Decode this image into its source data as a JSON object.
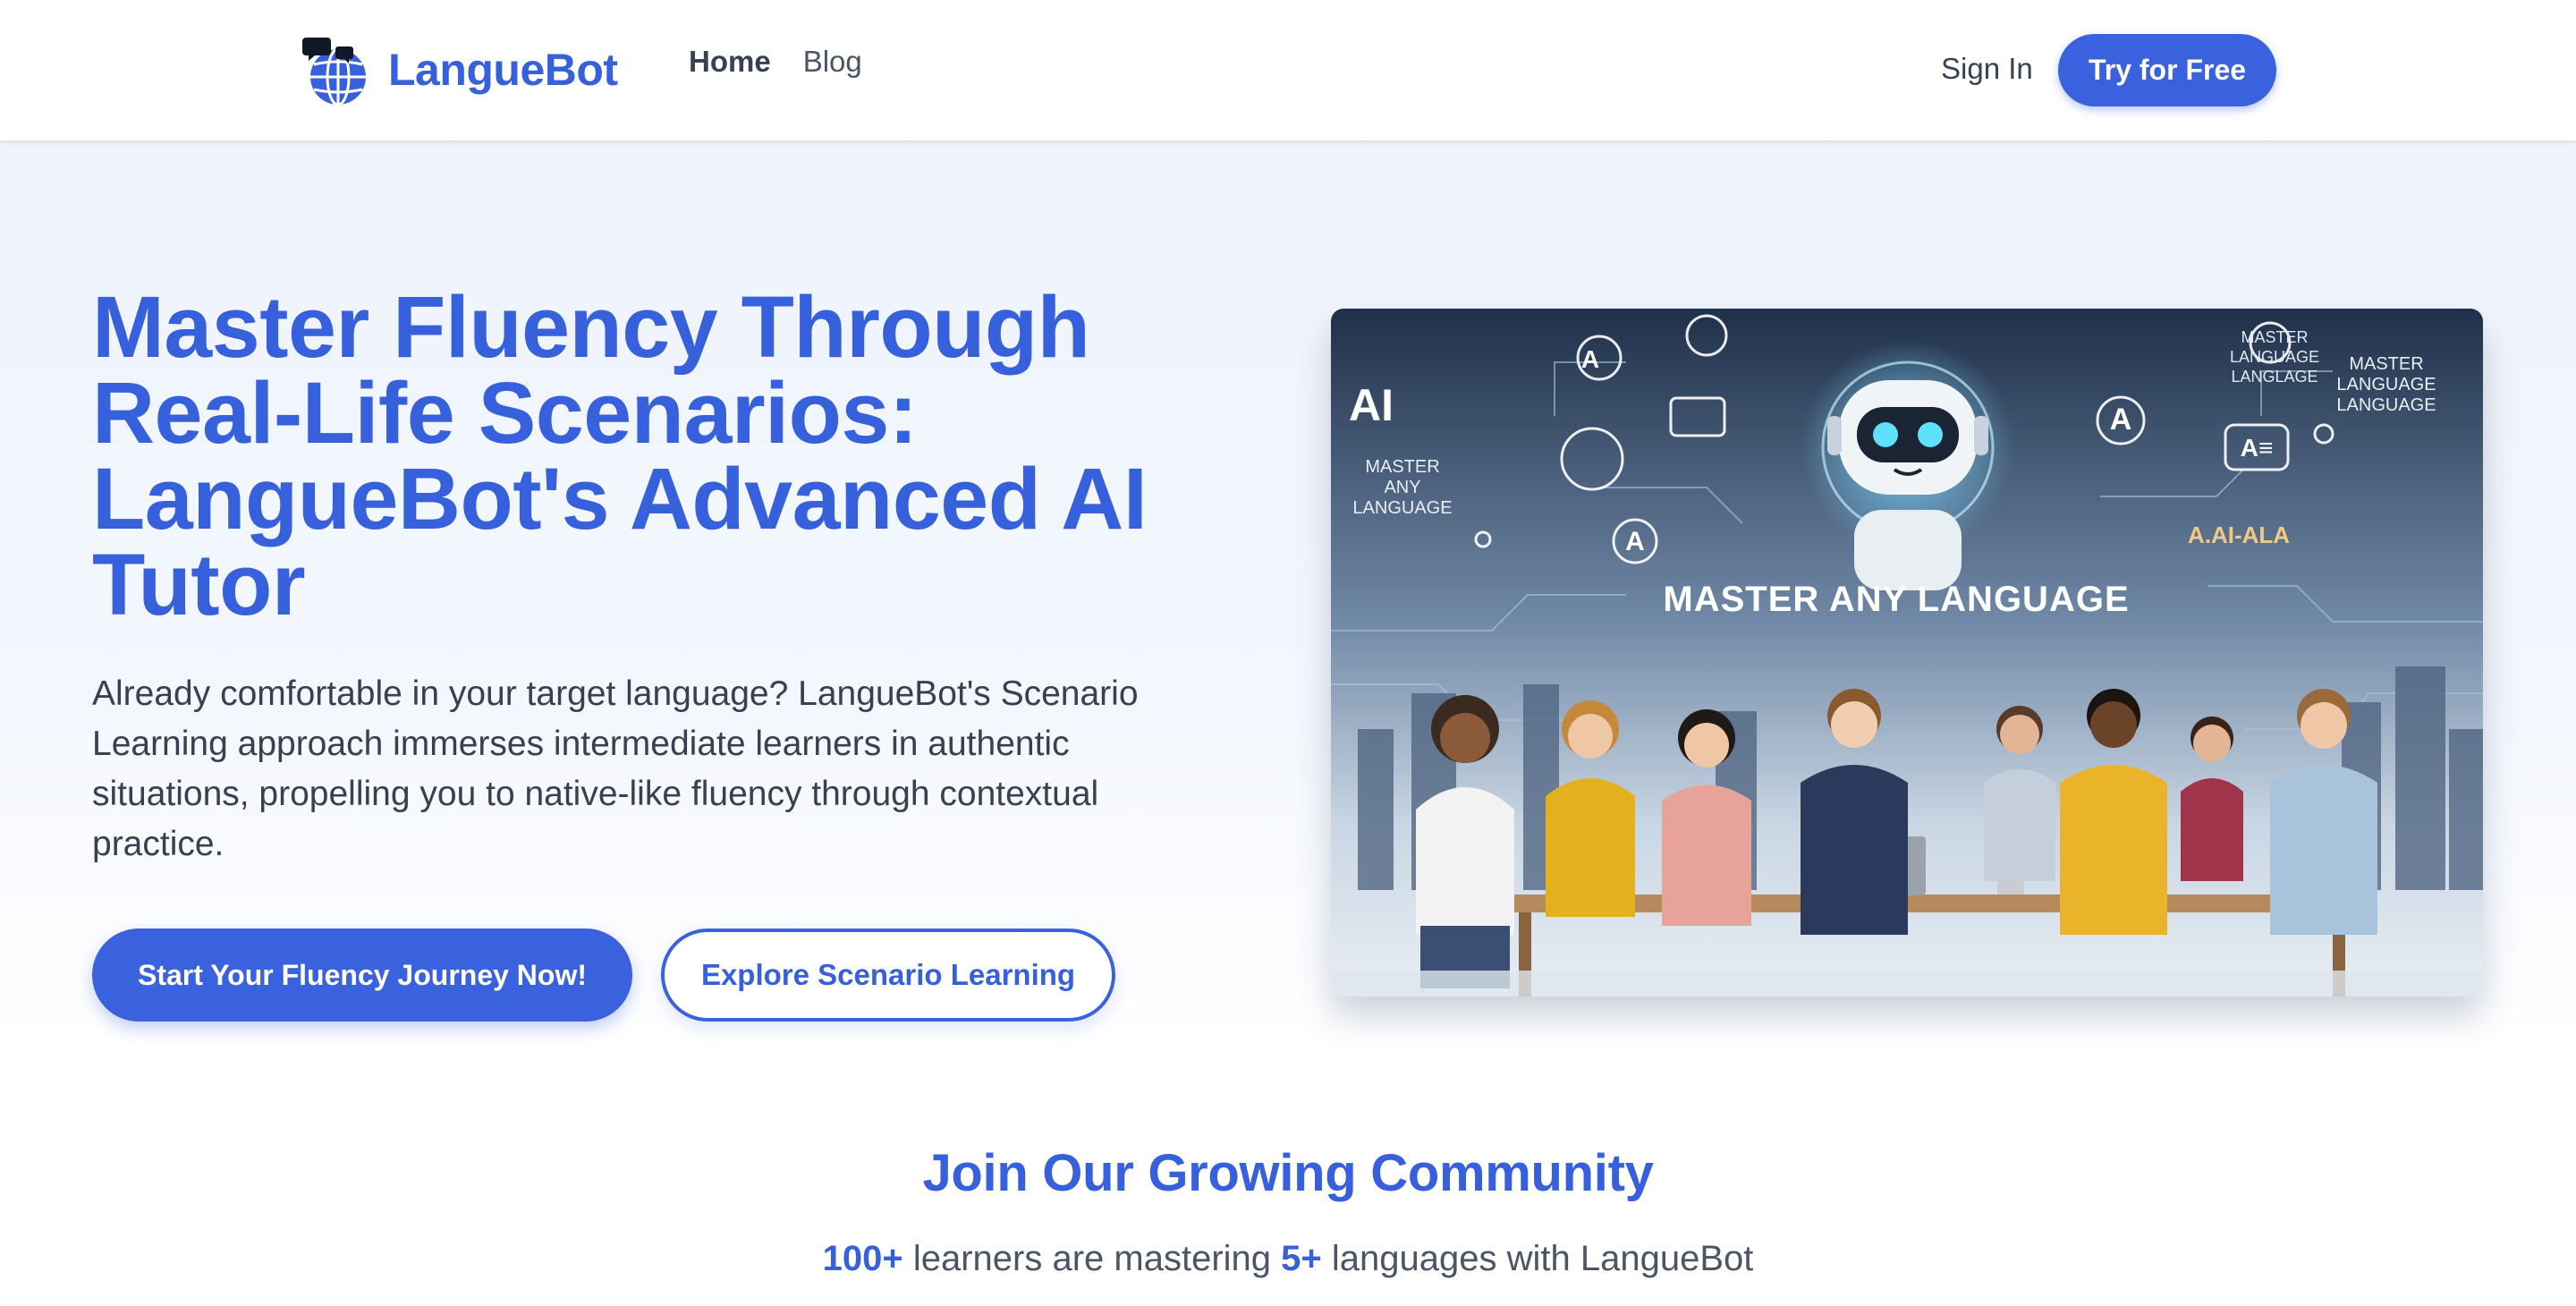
{
  "nav": {
    "brand": "LangueBot",
    "links": [
      {
        "label": "Home",
        "active": true
      },
      {
        "label": "Blog",
        "active": false
      }
    ],
    "sign_in": "Sign In",
    "cta": "Try for Free"
  },
  "hero": {
    "title": "Master Fluency Through Real-Life Scenarios: LangueBot's Advanced AI Tutor",
    "description": "Already comfortable in your target language? LangueBot's Scenario Learning approach immerses intermediate learners in authentic situations, propelling you to native-like fluency through contextual practice.",
    "primary_button": "Start Your Fluency Journey Now!",
    "secondary_button": "Explore Scenario Learning",
    "image": {
      "banner_text": "MASTER ANY LANGUAGE",
      "side_text_left": [
        "MASTER",
        "ANY",
        "LANGUAGE"
      ],
      "side_text_right": [
        "MASTER",
        "LANGUAGE",
        "LANGUAGE"
      ],
      "side_text_top_right": [
        "MASTER",
        "LANGUAGE",
        "LANGLAGE"
      ],
      "ai_text": "AI",
      "glyph_a": "A",
      "ai_row_text": "A.AI-ALA",
      "flag_glyph": "A≡"
    }
  },
  "community": {
    "title": "Join Our Growing Community",
    "learners_count": "100+",
    "text_middle": "learners are mastering",
    "languages_count": "5+",
    "text_end": "languages with LangueBot"
  },
  "colors": {
    "brand_blue": "#3760dc",
    "button_blue": "#3a61de",
    "text_dark": "#374151"
  },
  "icons": [
    "globe-chat-logo-icon"
  ]
}
